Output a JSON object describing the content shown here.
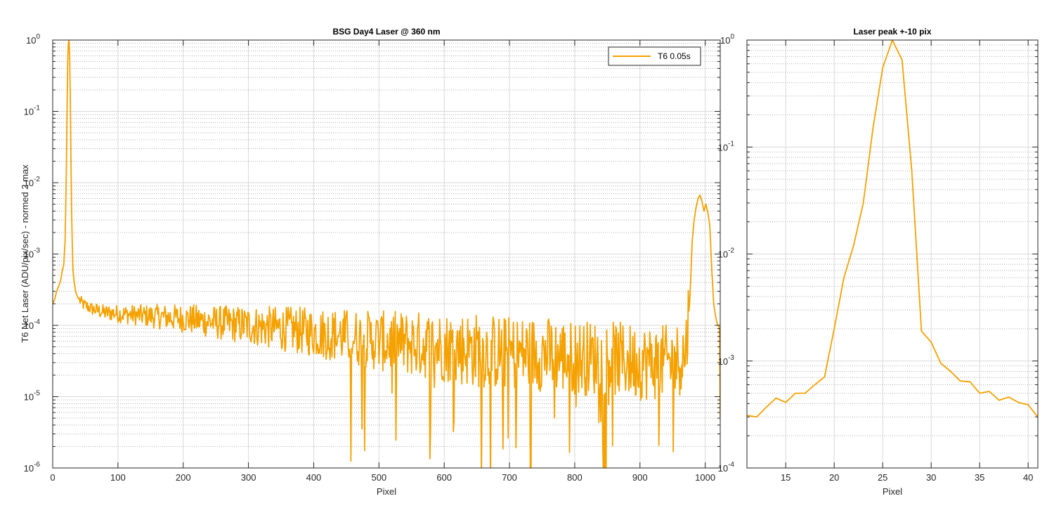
{
  "chart_data": [
    {
      "type": "line",
      "title": "BSG  Day4 Laser @ 360 nm",
      "xlabel": "Pixel",
      "ylabel": "T6 Net Laser (ADU/pix/sec) - normed 2 max",
      "xlim": [
        0,
        1023
      ],
      "ylim": [
        1e-06,
        1
      ],
      "yscale": "log",
      "xticks": [
        0,
        100,
        200,
        300,
        400,
        500,
        600,
        700,
        800,
        900,
        1000
      ],
      "yticks": [
        {
          "base": "10",
          "exp": "-6",
          "value": 1e-06
        },
        {
          "base": "10",
          "exp": "-5",
          "value": 1e-05
        },
        {
          "base": "10",
          "exp": "-4",
          "value": 0.0001
        },
        {
          "base": "10",
          "exp": "-3",
          "value": 0.001
        },
        {
          "base": "10",
          "exp": "-2",
          "value": 0.01
        },
        {
          "base": "10",
          "exp": "-1",
          "value": 0.1
        },
        {
          "base": "10",
          "exp": "0",
          "value": 1
        }
      ],
      "grid": true,
      "legend": {
        "position": "top-right",
        "entries": [
          "T6 0.05s"
        ]
      },
      "series": [
        {
          "name": "T6 0.05s",
          "color": "#F5A100",
          "x": [
            0,
            3,
            6,
            9,
            12,
            15,
            17,
            19,
            21,
            22,
            23,
            24,
            25,
            26,
            27,
            28,
            29,
            30,
            31,
            33,
            35,
            38,
            42,
            46,
            50,
            55,
            60,
            70,
            80,
            90,
            100,
            125,
            150,
            175,
            200,
            250,
            300,
            350,
            400,
            450,
            500,
            550,
            600,
            650,
            700,
            750,
            800,
            850,
            900,
            950,
            970,
            973,
            976,
            978,
            980,
            983,
            986,
            989,
            992,
            995,
            998,
            1001,
            1004,
            1007,
            1010,
            1013,
            1015,
            1017,
            1019,
            1021,
            1022,
            1023
          ],
          "y": [
            0.0002,
            0.00023,
            0.0003,
            0.00035,
            0.00042,
            0.0006,
            0.00072,
            0.0015,
            0.016,
            0.1,
            0.5,
            0.9,
            1.0,
            0.6,
            0.15,
            0.02,
            0.004,
            0.0013,
            0.0006,
            0.0004,
            0.0003,
            0.00025,
            0.00022,
            0.0002,
            0.00019,
            0.00018,
            0.00017,
            0.00016,
            0.00015,
            0.00015,
            0.000145,
            0.00014,
            0.000135,
            0.00013,
            0.000125,
            0.00011,
            0.0001,
            9e-05,
            8e-05,
            7e-05,
            6e-05,
            5.5e-05,
            5e-05,
            4.5e-05,
            4e-05,
            4e-05,
            3.5e-05,
            3.5e-05,
            3e-05,
            3e-05,
            4e-05,
            0.0001,
            0.0002,
            0.0005,
            0.0015,
            0.003,
            0.0045,
            0.006,
            0.0067,
            0.0055,
            0.004,
            0.005,
            0.0038,
            0.0025,
            0.0006,
            0.0002,
            0.00015,
            0.00012,
            0.0001,
            0.0001,
            8e-05,
            5e-06
          ]
        }
      ],
      "noise_note_x_start": 40
    },
    {
      "type": "line",
      "title": "Laser peak +-10 pix",
      "xlabel": "Pixel",
      "ylabel": "",
      "xlim": [
        11,
        41
      ],
      "ylim": [
        0.0001,
        1
      ],
      "yscale": "log",
      "xticks": [
        15,
        20,
        25,
        30,
        35,
        40
      ],
      "yticks": [
        {
          "base": "10",
          "exp": "-4",
          "value": 0.0001
        },
        {
          "base": "10",
          "exp": "-3",
          "value": 0.001
        },
        {
          "base": "10",
          "exp": "-2",
          "value": 0.01
        },
        {
          "base": "10",
          "exp": "-1",
          "value": 0.1
        },
        {
          "base": "10",
          "exp": "0",
          "value": 1
        }
      ],
      "grid": true,
      "series": [
        {
          "name": "T6 0.05s",
          "color": "#F5A100",
          "x": [
            11,
            12,
            13,
            14,
            15,
            16,
            17,
            18,
            19,
            20,
            21,
            22,
            23,
            24,
            25,
            26,
            27,
            28,
            29,
            30,
            31,
            32,
            33,
            34,
            35,
            36,
            37,
            38,
            39,
            40,
            41
          ],
          "y": [
            0.00031,
            0.0003,
            0.00037,
            0.00045,
            0.00041,
            0.0005,
            0.0005,
            0.0006,
            0.00071,
            0.002,
            0.006,
            0.012,
            0.03,
            0.15,
            0.55,
            1.0,
            0.65,
            0.06,
            0.0019,
            0.0015,
            0.00095,
            0.0008,
            0.00065,
            0.00064,
            0.0005,
            0.00052,
            0.00043,
            0.00046,
            0.00041,
            0.00039,
            0.0003
          ]
        }
      ]
    }
  ]
}
